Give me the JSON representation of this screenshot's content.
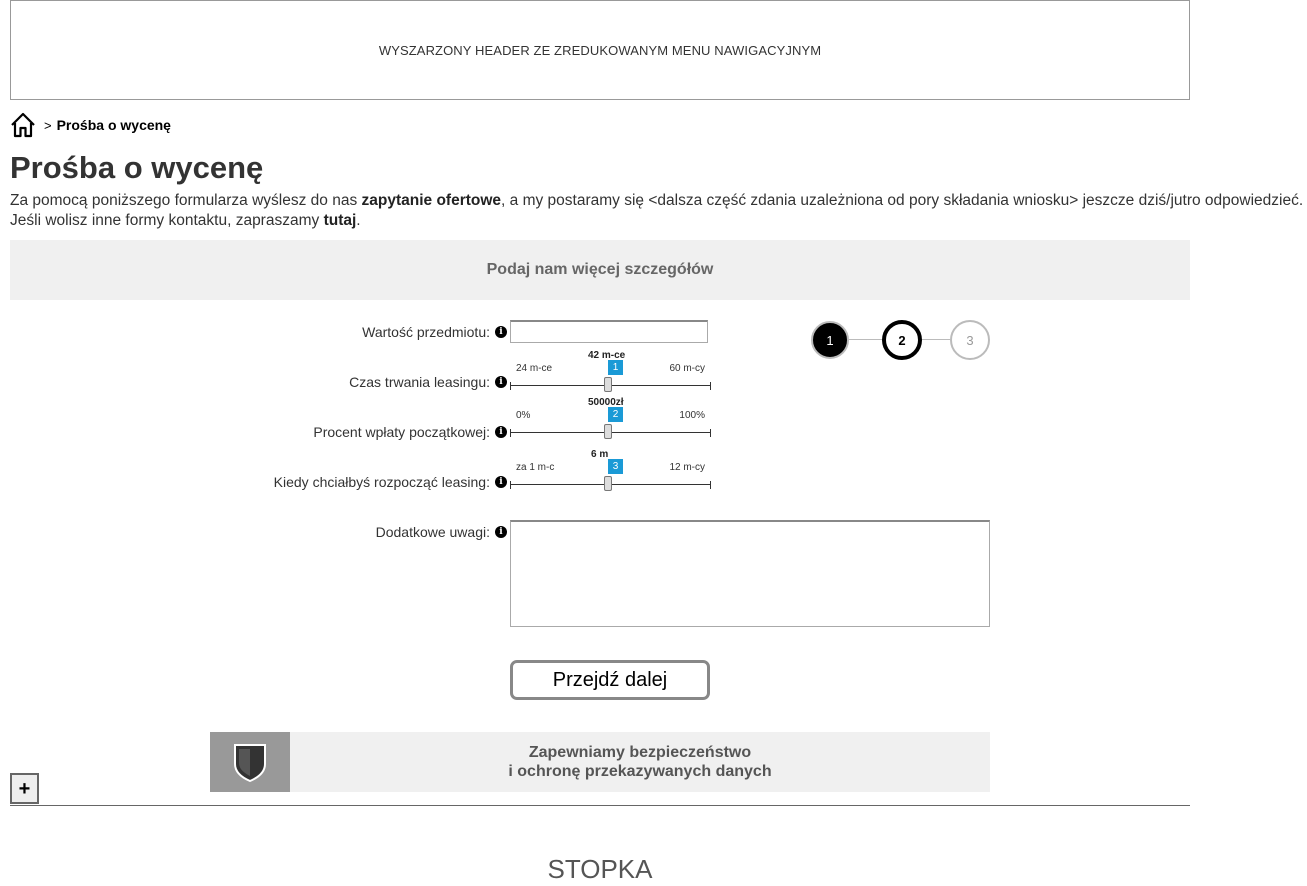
{
  "header": {
    "placeholder": "WYSZARZONY HEADER ZE ZREDUKOWANYM MENU NAWIGACYJNYM"
  },
  "breadcrumb": {
    "separator": ">",
    "current": "Prośba o wycenę"
  },
  "page": {
    "title": "Prośba o wycenę",
    "intro": {
      "line1_before": "Za pomocą poniższego formularza wyślesz do nas ",
      "line1_bold": "zapytanie ofertowe",
      "line1_after": ", a my postaramy się <dalsza część zdania uzależniona od pory składania wniosku> jeszcze dziś/jutro odpowiedzieć.",
      "line2_before": "Jeśli wolisz inne formy kontaktu, zapraszamy ",
      "line2_link": "tutaj",
      "line2_after": "."
    }
  },
  "form": {
    "section_title": "Podaj nam więcej szczegółów",
    "fields": {
      "item_value": {
        "label": "Wartość przedmiotu:",
        "value": ""
      },
      "lease_duration": {
        "label": "Czas trwania leasingu:",
        "min_label": "24 m-ce",
        "max_label": "60 m-cy",
        "value_label": "42 m-ce",
        "badge": "1"
      },
      "down_payment": {
        "label": "Procent wpłaty początkowej:",
        "min_label": "0%",
        "max_label": "100%",
        "value_label": "50000zł",
        "badge": "2"
      },
      "start_time": {
        "label": "Kiedy chciałbyś rozpocząć leasing:",
        "min_label": "za 1 m-c",
        "max_label": "12 m-cy",
        "value_label": "6 m",
        "badge": "3"
      },
      "notes": {
        "label": "Dodatkowe uwagi:",
        "value": ""
      }
    },
    "info_glyph": "i",
    "submit_label": "Przejdź dalej"
  },
  "steps": {
    "items": [
      "1",
      "2",
      "3"
    ],
    "current": "2"
  },
  "security": {
    "line1": "Zapewniamy bezpieczeństwo",
    "line2": "i ochronę przekazywanych danych",
    "icon": "shield-icon"
  },
  "expand": {
    "label": "+"
  },
  "footer": {
    "label": "STOPKA"
  },
  "colors": {
    "accent": "#1a9ad6",
    "band": "#f0f0f0",
    "shield_bg": "#999999"
  }
}
